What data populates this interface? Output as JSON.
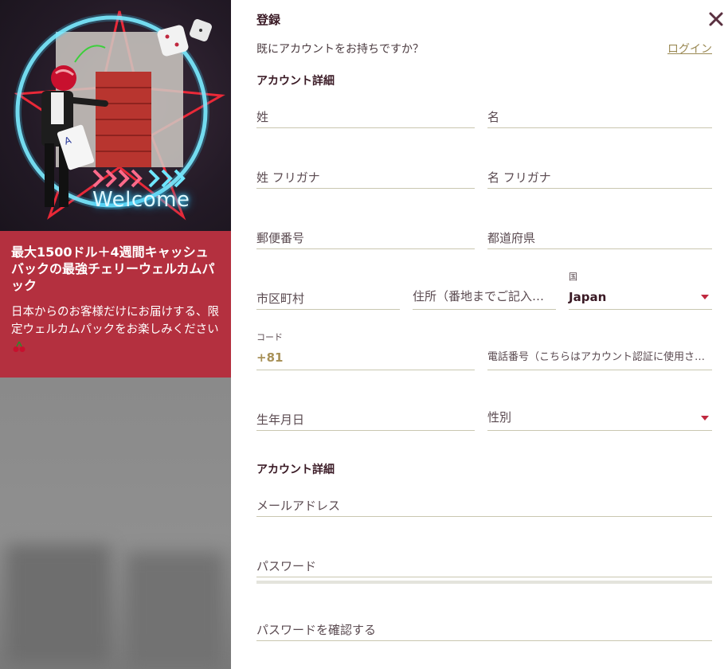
{
  "promo": {
    "welcome_text": "Welcome",
    "title": "最大1500ドル＋4週間キャッシュバックの最強チェリーウェルカムパック",
    "description": "日本からのお客様だけにお届けする、限定ウェルカムパックをお楽しみください",
    "accent_color": "#b4303f"
  },
  "form": {
    "title": "登録",
    "have_account_text": "既にアカウントをお持ちですか？",
    "login_link": "ログイン",
    "section1_heading": "アカウント詳細",
    "last_name_placeholder": "姓",
    "first_name_placeholder": "名",
    "last_name_kana_placeholder": "姓 フリガナ",
    "first_name_kana_placeholder": "名 フリガナ",
    "postal_code_placeholder": "郵便番号",
    "prefecture_placeholder": "都道府県",
    "city_placeholder": "市区町村",
    "address_placeholder": "住所（番地までご記入ください）",
    "country_label": "国",
    "country_value": "Japan",
    "code_label": "コード",
    "code_value": "+81",
    "phone_placeholder": "電話番号（こちらはアカウント認証に使用されます）",
    "birthdate_placeholder": "生年月日",
    "gender_placeholder": "性別",
    "section2_heading": "アカウント詳細",
    "email_placeholder": "メールアドレス",
    "password_placeholder": "パスワード",
    "confirm_password_placeholder": "パスワードを確認する"
  },
  "colors": {
    "heading": "#3a1a25",
    "link": "#9b8a55",
    "underline": "#c9c7b0",
    "caret": "#c0283f"
  }
}
